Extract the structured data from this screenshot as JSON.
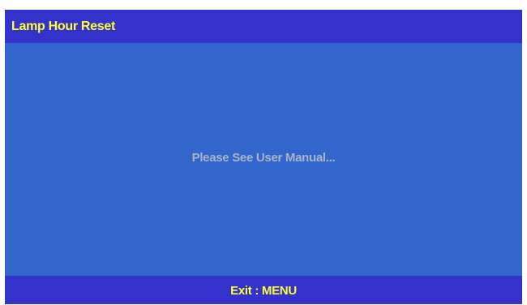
{
  "header": {
    "title": "Lamp Hour Reset"
  },
  "main": {
    "message": "Please See User Manual..."
  },
  "footer": {
    "exit_hint": "Exit : MENU"
  },
  "colors": {
    "bar_background": "#3333cc",
    "content_background": "#3366cc",
    "highlight_text": "#ffff33",
    "message_text": "#aab4c8"
  }
}
